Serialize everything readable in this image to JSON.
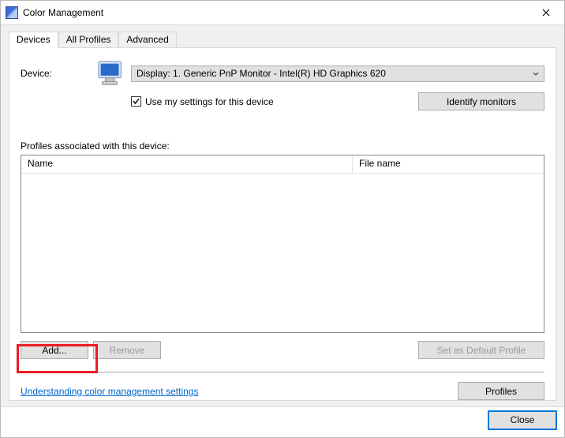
{
  "titlebar": {
    "title": "Color Management"
  },
  "tabs": {
    "devices": "Devices",
    "all_profiles": "All Profiles",
    "advanced": "Advanced"
  },
  "device": {
    "label": "Device:",
    "selected": "Display: 1. Generic PnP Monitor - Intel(R) HD Graphics 620",
    "use_my_settings": "Use my settings for this device",
    "identify": "Identify monitors"
  },
  "profiles": {
    "label": "Profiles associated with this device:",
    "columns": {
      "name": "Name",
      "file": "File name"
    }
  },
  "buttons": {
    "add": "Add...",
    "remove": "Remove",
    "set_default": "Set as Default Profile",
    "profiles": "Profiles",
    "close": "Close"
  },
  "link": {
    "understanding": "Understanding color management settings"
  }
}
